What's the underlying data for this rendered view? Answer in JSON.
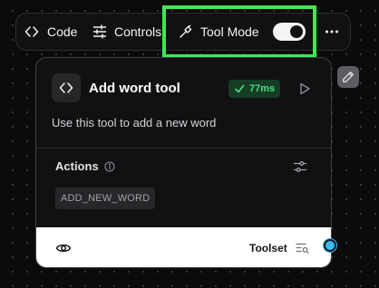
{
  "toolbar": {
    "code_label": "Code",
    "controls_label": "Controls",
    "tool_mode_label": "Tool Mode",
    "tool_mode_enabled": true,
    "more_icon": "more-horizontal-icon"
  },
  "node": {
    "title": "Add word tool",
    "description": "Use this tool to add a new word",
    "icon": "code-brackets-icon",
    "run_time": "77ms",
    "status": "success",
    "status_color": "#4ade80"
  },
  "actions": {
    "label": "Actions",
    "items": [
      "ADD_NEW_WORD"
    ]
  },
  "footer": {
    "output_label": "Toolset"
  },
  "colors": {
    "highlight": "#3ee84e",
    "handle": "#38bdf8",
    "background": "#0b0b0c"
  }
}
